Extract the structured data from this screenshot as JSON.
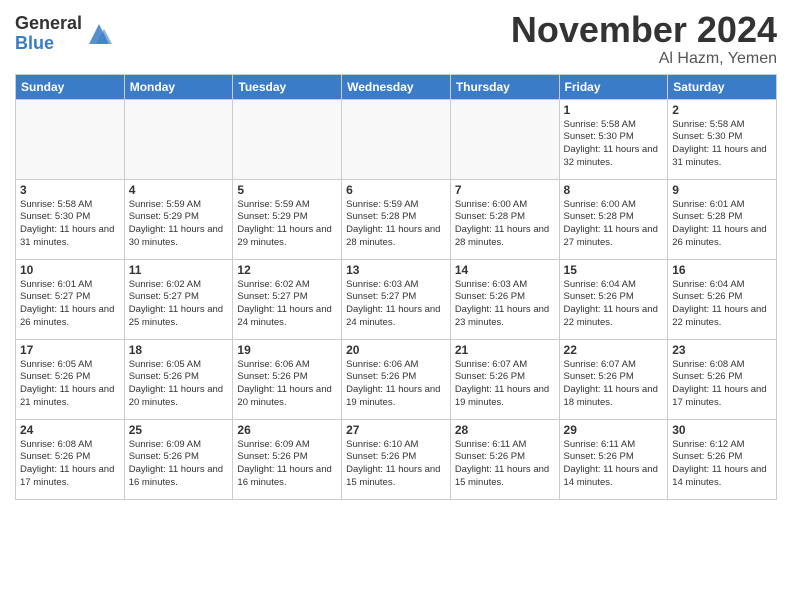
{
  "header": {
    "logo_general": "General",
    "logo_blue": "Blue",
    "month_title": "November 2024",
    "location": "Al Hazm, Yemen"
  },
  "weekdays": [
    "Sunday",
    "Monday",
    "Tuesday",
    "Wednesday",
    "Thursday",
    "Friday",
    "Saturday"
  ],
  "weeks": [
    [
      {
        "day": "",
        "info": ""
      },
      {
        "day": "",
        "info": ""
      },
      {
        "day": "",
        "info": ""
      },
      {
        "day": "",
        "info": ""
      },
      {
        "day": "",
        "info": ""
      },
      {
        "day": "1",
        "info": "Sunrise: 5:58 AM\nSunset: 5:30 PM\nDaylight: 11 hours\nand 32 minutes."
      },
      {
        "day": "2",
        "info": "Sunrise: 5:58 AM\nSunset: 5:30 PM\nDaylight: 11 hours\nand 31 minutes."
      }
    ],
    [
      {
        "day": "3",
        "info": "Sunrise: 5:58 AM\nSunset: 5:30 PM\nDaylight: 11 hours\nand 31 minutes."
      },
      {
        "day": "4",
        "info": "Sunrise: 5:59 AM\nSunset: 5:29 PM\nDaylight: 11 hours\nand 30 minutes."
      },
      {
        "day": "5",
        "info": "Sunrise: 5:59 AM\nSunset: 5:29 PM\nDaylight: 11 hours\nand 29 minutes."
      },
      {
        "day": "6",
        "info": "Sunrise: 5:59 AM\nSunset: 5:28 PM\nDaylight: 11 hours\nand 28 minutes."
      },
      {
        "day": "7",
        "info": "Sunrise: 6:00 AM\nSunset: 5:28 PM\nDaylight: 11 hours\nand 28 minutes."
      },
      {
        "day": "8",
        "info": "Sunrise: 6:00 AM\nSunset: 5:28 PM\nDaylight: 11 hours\nand 27 minutes."
      },
      {
        "day": "9",
        "info": "Sunrise: 6:01 AM\nSunset: 5:28 PM\nDaylight: 11 hours\nand 26 minutes."
      }
    ],
    [
      {
        "day": "10",
        "info": "Sunrise: 6:01 AM\nSunset: 5:27 PM\nDaylight: 11 hours\nand 26 minutes."
      },
      {
        "day": "11",
        "info": "Sunrise: 6:02 AM\nSunset: 5:27 PM\nDaylight: 11 hours\nand 25 minutes."
      },
      {
        "day": "12",
        "info": "Sunrise: 6:02 AM\nSunset: 5:27 PM\nDaylight: 11 hours\nand 24 minutes."
      },
      {
        "day": "13",
        "info": "Sunrise: 6:03 AM\nSunset: 5:27 PM\nDaylight: 11 hours\nand 24 minutes."
      },
      {
        "day": "14",
        "info": "Sunrise: 6:03 AM\nSunset: 5:26 PM\nDaylight: 11 hours\nand 23 minutes."
      },
      {
        "day": "15",
        "info": "Sunrise: 6:04 AM\nSunset: 5:26 PM\nDaylight: 11 hours\nand 22 minutes."
      },
      {
        "day": "16",
        "info": "Sunrise: 6:04 AM\nSunset: 5:26 PM\nDaylight: 11 hours\nand 22 minutes."
      }
    ],
    [
      {
        "day": "17",
        "info": "Sunrise: 6:05 AM\nSunset: 5:26 PM\nDaylight: 11 hours\nand 21 minutes."
      },
      {
        "day": "18",
        "info": "Sunrise: 6:05 AM\nSunset: 5:26 PM\nDaylight: 11 hours\nand 20 minutes."
      },
      {
        "day": "19",
        "info": "Sunrise: 6:06 AM\nSunset: 5:26 PM\nDaylight: 11 hours\nand 20 minutes."
      },
      {
        "day": "20",
        "info": "Sunrise: 6:06 AM\nSunset: 5:26 PM\nDaylight: 11 hours\nand 19 minutes."
      },
      {
        "day": "21",
        "info": "Sunrise: 6:07 AM\nSunset: 5:26 PM\nDaylight: 11 hours\nand 19 minutes."
      },
      {
        "day": "22",
        "info": "Sunrise: 6:07 AM\nSunset: 5:26 PM\nDaylight: 11 hours\nand 18 minutes."
      },
      {
        "day": "23",
        "info": "Sunrise: 6:08 AM\nSunset: 5:26 PM\nDaylight: 11 hours\nand 17 minutes."
      }
    ],
    [
      {
        "day": "24",
        "info": "Sunrise: 6:08 AM\nSunset: 5:26 PM\nDaylight: 11 hours\nand 17 minutes."
      },
      {
        "day": "25",
        "info": "Sunrise: 6:09 AM\nSunset: 5:26 PM\nDaylight: 11 hours\nand 16 minutes."
      },
      {
        "day": "26",
        "info": "Sunrise: 6:09 AM\nSunset: 5:26 PM\nDaylight: 11 hours\nand 16 minutes."
      },
      {
        "day": "27",
        "info": "Sunrise: 6:10 AM\nSunset: 5:26 PM\nDaylight: 11 hours\nand 15 minutes."
      },
      {
        "day": "28",
        "info": "Sunrise: 6:11 AM\nSunset: 5:26 PM\nDaylight: 11 hours\nand 15 minutes."
      },
      {
        "day": "29",
        "info": "Sunrise: 6:11 AM\nSunset: 5:26 PM\nDaylight: 11 hours\nand 14 minutes."
      },
      {
        "day": "30",
        "info": "Sunrise: 6:12 AM\nSunset: 5:26 PM\nDaylight: 11 hours\nand 14 minutes."
      }
    ]
  ]
}
